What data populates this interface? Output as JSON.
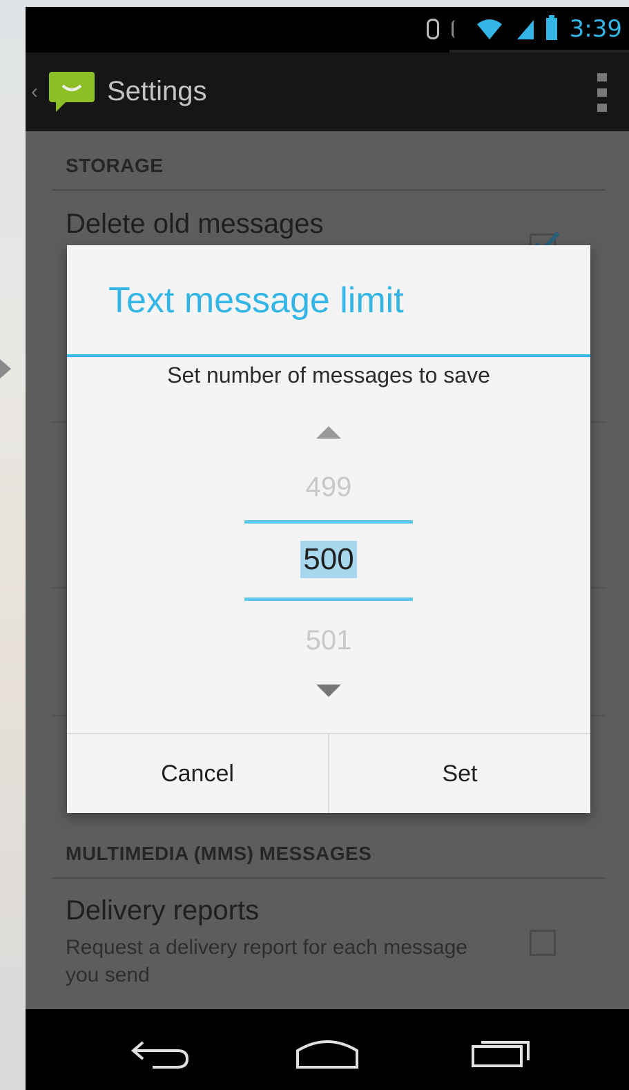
{
  "statusbar": {
    "time": "3:39",
    "icons": [
      "bluetooth-icon",
      "vibrate-icon",
      "wifi-icon",
      "signal-icon",
      "battery-icon"
    ],
    "accent_color": "#33b5e5"
  },
  "actionbar": {
    "title": "Settings",
    "app_icon": "messaging-app-icon",
    "overflow_icon": "overflow-menu-icon"
  },
  "settings": {
    "sections": [
      {
        "header": "STORAGE"
      },
      {
        "header": "MULTIMEDIA (MMS) MESSAGES"
      }
    ],
    "items": [
      {
        "title": "Delete old messages",
        "checked": true
      },
      {
        "title": "Delivery reports",
        "summary": "Request a delivery report for each message you send",
        "checked": false
      }
    ]
  },
  "dialog": {
    "title": "Text message limit",
    "message": "Set number of messages to save",
    "picker": {
      "previous": "499",
      "current": "500",
      "next": "501"
    },
    "buttons": {
      "cancel": "Cancel",
      "set": "Set"
    },
    "title_color": "#33b5e5"
  },
  "navbar": {
    "buttons": [
      "back-icon",
      "home-icon",
      "recent-apps-icon"
    ]
  }
}
